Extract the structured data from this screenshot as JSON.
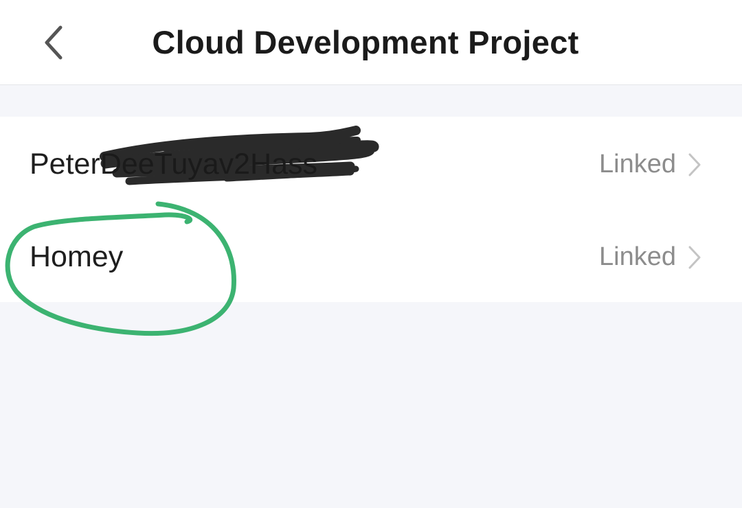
{
  "header": {
    "title": "Cloud Development Project",
    "back_icon": "chevron-left-icon"
  },
  "projects": [
    {
      "name": "PeterDeeTuyav2Hass",
      "status": "Linked",
      "redacted": true
    },
    {
      "name": "Homey",
      "status": "Linked",
      "highlighted": true
    }
  ],
  "colors": {
    "page_background": "#f5f6fa",
    "card_background": "#ffffff",
    "title_text": "#1b1b1b",
    "status_text": "#8c8c8c",
    "annotation_green": "#3cb371",
    "redaction_black": "#1a1a1a"
  }
}
